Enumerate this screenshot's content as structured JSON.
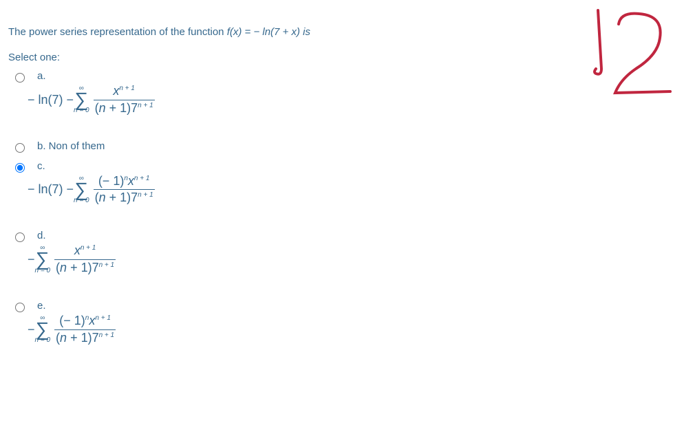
{
  "question": {
    "prefix": "The power series representation of the function ",
    "formula_fx": "f(x)",
    "formula_eq": " = − ln(7 + ",
    "formula_x": "x",
    "formula_end": ") is"
  },
  "select_label": "Select one:",
  "options": {
    "a": {
      "label": "a.",
      "prefix": "− ln(7) − ",
      "sigma_top": "∞",
      "sigma_sub": "n = 0",
      "num_x": "x",
      "num_sup": "n + 1",
      "den_left": "(",
      "den_n": "n",
      "den_mid": " + 1)7",
      "den_sup": "n + 1"
    },
    "b": {
      "label": "b. Non of them"
    },
    "c": {
      "label": "c.",
      "prefix": "− ln(7) − ",
      "sigma_top": "∞",
      "sigma_sub": "n = 0",
      "num_neg1": "(− 1)",
      "num_neg1_sup": "n",
      "num_x": "x",
      "num_sup": "n + 1",
      "den_left": "(",
      "den_n": "n",
      "den_mid": " + 1)7",
      "den_sup": "n + 1"
    },
    "d": {
      "label": "d.",
      "prefix": "− ",
      "sigma_top": "∞",
      "sigma_sub": "n = 0",
      "num_x": "x",
      "num_sup": "n + 1",
      "den_left": "(",
      "den_n": "n",
      "den_mid": " + 1)7",
      "den_sup": "n + 1"
    },
    "e": {
      "label": "e.",
      "prefix": "− ",
      "sigma_top": "∞",
      "sigma_sub": "n = 0",
      "num_neg1": "(− 1)",
      "num_neg1_sup": "n",
      "num_x": "x",
      "num_sup": "n + 1",
      "den_left": "(",
      "den_n": "n",
      "den_mid": " + 1)7",
      "den_sup": "n + 1"
    }
  },
  "selected": "c",
  "annotation_value": "12"
}
